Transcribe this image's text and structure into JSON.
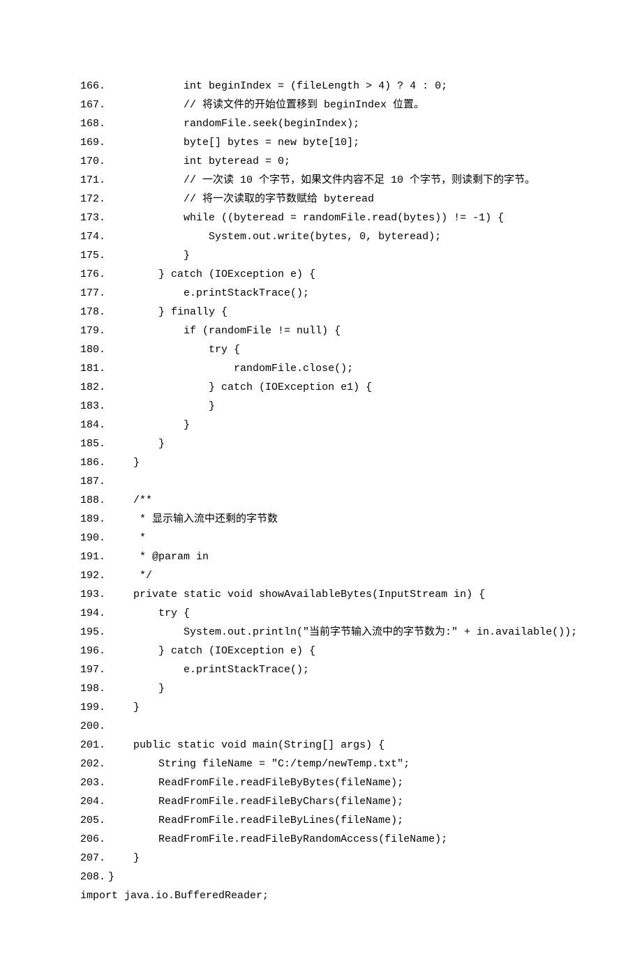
{
  "lines": [
    {
      "n": "166.",
      "c": "            int beginIndex = (fileLength > 4) ? 4 : 0;  "
    },
    {
      "n": "167.",
      "c": "            // 将读文件的开始位置移到 beginIndex 位置。  "
    },
    {
      "n": "168.",
      "c": "            randomFile.seek(beginIndex);  "
    },
    {
      "n": "169.",
      "c": "            byte[] bytes = new byte[10];  "
    },
    {
      "n": "170.",
      "c": "            int byteread = 0;  "
    },
    {
      "n": "171.",
      "c": "            // 一次读 10 个字节，如果文件内容不足 10 个字节，则读剩下的字节。  "
    },
    {
      "n": "172.",
      "c": "            // 将一次读取的字节数赋给 byteread  "
    },
    {
      "n": "173.",
      "c": "            while ((byteread = randomFile.read(bytes)) != -1) {  "
    },
    {
      "n": "174.",
      "c": "                System.out.write(bytes, 0, byteread);  "
    },
    {
      "n": "175.",
      "c": "            }  "
    },
    {
      "n": "176.",
      "c": "        } catch (IOException e) {  "
    },
    {
      "n": "177.",
      "c": "            e.printStackTrace();  "
    },
    {
      "n": "178.",
      "c": "        } finally {  "
    },
    {
      "n": "179.",
      "c": "            if (randomFile != null) {  "
    },
    {
      "n": "180.",
      "c": "                try {  "
    },
    {
      "n": "181.",
      "c": "                    randomFile.close();  "
    },
    {
      "n": "182.",
      "c": "                } catch (IOException e1) {  "
    },
    {
      "n": "183.",
      "c": "                }  "
    },
    {
      "n": "184.",
      "c": "            }  "
    },
    {
      "n": "185.",
      "c": "        }  "
    },
    {
      "n": "186.",
      "c": "    }  "
    },
    {
      "n": "187.",
      "c": "  "
    },
    {
      "n": "188.",
      "c": "    /** "
    },
    {
      "n": "189.",
      "c": "     * 显示输入流中还剩的字节数 "
    },
    {
      "n": "190.",
      "c": "     *  "
    },
    {
      "n": "191.",
      "c": "     * @param in "
    },
    {
      "n": "192.",
      "c": "     */  "
    },
    {
      "n": "193.",
      "c": "    private static void showAvailableBytes(InputStream in) {  "
    },
    {
      "n": "194.",
      "c": "        try {  "
    },
    {
      "n": "195.",
      "c": "            System.out.println(\"当前字节输入流中的字节数为:\" + in.available());  "
    },
    {
      "n": "196.",
      "c": "        } catch (IOException e) {  "
    },
    {
      "n": "197.",
      "c": "            e.printStackTrace();  "
    },
    {
      "n": "198.",
      "c": "        }  "
    },
    {
      "n": "199.",
      "c": "    }  "
    },
    {
      "n": "200.",
      "c": "  "
    },
    {
      "n": "201.",
      "c": "    public static void main(String[] args) {  "
    },
    {
      "n": "202.",
      "c": "        String fileName = \"C:/temp/newTemp.txt\";  "
    },
    {
      "n": "203.",
      "c": "        ReadFromFile.readFileByBytes(fileName);  "
    },
    {
      "n": "204.",
      "c": "        ReadFromFile.readFileByChars(fileName);  "
    },
    {
      "n": "205.",
      "c": "        ReadFromFile.readFileByLines(fileName);  "
    },
    {
      "n": "206.",
      "c": "        ReadFromFile.readFileByRandomAccess(fileName);  "
    },
    {
      "n": "207.",
      "c": "    }  "
    },
    {
      "n": "208.",
      "c": "}  "
    }
  ],
  "after": "import java.io.BufferedReader;"
}
